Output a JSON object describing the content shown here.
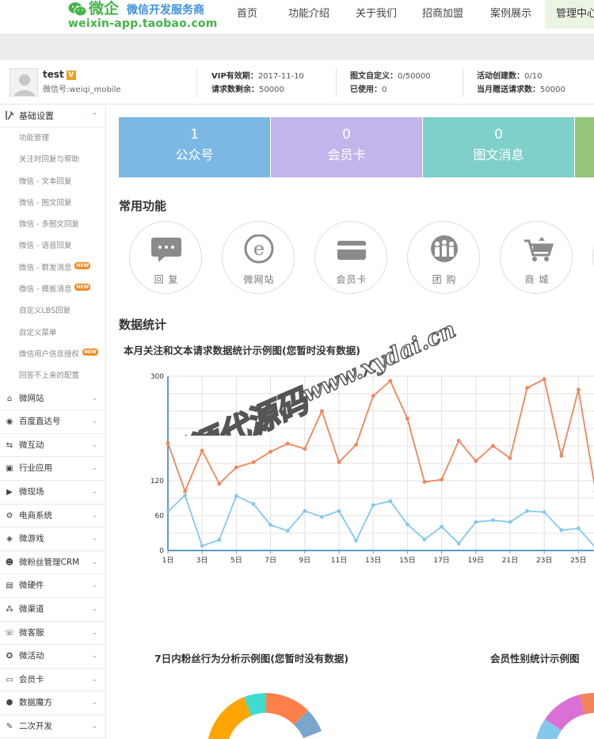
{
  "header": {
    "brand": "微企",
    "slogan": "微信开发服务商",
    "domain": "weixin-app.taobao.com",
    "nav": [
      "首页",
      "功能介绍",
      "关于我们",
      "招商加盟",
      "案例展示",
      "管理中心"
    ]
  },
  "account": {
    "name": "test",
    "badge": "V",
    "wechat_id": "微信号:weiqi_mobile",
    "vip_label": "VIP有效期：",
    "vip_value": "2017-11-10",
    "requests_label": "请求数剩余：",
    "requests_value": "50000",
    "custom_label": "图文自定义：",
    "custom_value": "0/50000",
    "used_label": "已使用：",
    "used_value": "0",
    "activity_label": "活动创建数：",
    "activity_value": "0/10",
    "gift_label": "当月赠送请求数：",
    "gift_value": "50000"
  },
  "sidebar": {
    "basic": {
      "label": "基础设置",
      "items": [
        {
          "label": "功能管理",
          "new": false
        },
        {
          "label": "关注时回复与帮助",
          "new": false
        },
        {
          "label": "微信 - 文本回复",
          "new": false
        },
        {
          "label": "微信 - 图文回复",
          "new": false
        },
        {
          "label": "微信 - 多图文回复",
          "new": false
        },
        {
          "label": "微信 - 语音回复",
          "new": false
        },
        {
          "label": "微信 - 群发消息",
          "new": true
        },
        {
          "label": "微信 - 模板消息",
          "new": true
        },
        {
          "label": "自定义LBS回复",
          "new": false
        },
        {
          "label": "自定义菜单",
          "new": false
        },
        {
          "label": "微信用户信息授权",
          "new": true
        },
        {
          "label": "回答不上来的配置",
          "new": false
        }
      ],
      "new_badge": "NEW"
    },
    "groups": [
      {
        "label": "微网站",
        "icon": "home-icon"
      },
      {
        "label": "百度直达号",
        "icon": "baidu-icon"
      },
      {
        "label": "微互动",
        "icon": "interact-icon"
      },
      {
        "label": "行业应用",
        "icon": "industry-icon"
      },
      {
        "label": "微现场",
        "icon": "video-icon"
      },
      {
        "label": "电商系统",
        "icon": "gear-icon"
      },
      {
        "label": "微游戏",
        "icon": "gamepad-icon"
      },
      {
        "label": "微粉丝管理CRM",
        "icon": "fans-icon"
      },
      {
        "label": "微硬件",
        "icon": "hardware-icon"
      },
      {
        "label": "微渠道",
        "icon": "channel-icon"
      },
      {
        "label": "微客服",
        "icon": "service-icon"
      },
      {
        "label": "微活动",
        "icon": "activity-icon"
      },
      {
        "label": "会员卡",
        "icon": "card-icon"
      },
      {
        "label": "数据魔方",
        "icon": "cube-icon"
      },
      {
        "label": "二次开发",
        "icon": "wrench-icon"
      }
    ]
  },
  "tiles": [
    {
      "num": "1",
      "label": "公众号",
      "color": "#7cb8e4"
    },
    {
      "num": "0",
      "label": "会员卡",
      "color": "#c4b4ec"
    },
    {
      "num": "0",
      "label": "图文消息",
      "color": "#7fd0ca"
    },
    {
      "num": "",
      "label": "",
      "color": "#96c479"
    }
  ],
  "sections": {
    "common": "常用功能",
    "stats": "数据统计"
  },
  "functions": [
    {
      "label": "回 复",
      "icon": "reply-icon"
    },
    {
      "label": "微网站",
      "icon": "website-icon"
    },
    {
      "label": "会员卡",
      "icon": "card-icon"
    },
    {
      "label": "团 购",
      "icon": "group-buy-icon"
    },
    {
      "label": "商 城",
      "icon": "mall-icon"
    }
  ],
  "chart_data": {
    "type": "line",
    "title": "本月关注和文本请求数据统计示例图(您暂时没有数据)",
    "x_labels": [
      "1日",
      "3日",
      "5日",
      "7日",
      "9日",
      "11日",
      "13日",
      "15日",
      "17日",
      "19日",
      "21日",
      "23日",
      "25日"
    ],
    "x": [
      1,
      2,
      3,
      4,
      5,
      6,
      7,
      8,
      9,
      10,
      11,
      12,
      13,
      14,
      15,
      16,
      17,
      18,
      19,
      20,
      21,
      22,
      23,
      24,
      25,
      26
    ],
    "y_ticks": [
      0,
      60,
      120,
      300
    ],
    "ylim": [
      0,
      300
    ],
    "grid": true,
    "series": [
      {
        "color": "#f2845a",
        "values": [
          185,
          102,
          172,
          115,
          143,
          152,
          170,
          184,
          175,
          240,
          152,
          182,
          266,
          292,
          227,
          118,
          122,
          189,
          154,
          180,
          159,
          280,
          295,
          163,
          277,
          102
        ]
      },
      {
        "color": "#84c8ee",
        "values": [
          67,
          95,
          8,
          18,
          94,
          80,
          44,
          34,
          68,
          58,
          68,
          17,
          78,
          85,
          45,
          19,
          41,
          12,
          49,
          52,
          49,
          68,
          66,
          35,
          38,
          5
        ]
      }
    ]
  },
  "sub_charts": {
    "fans": "7日内粉丝行为分析示例图(您暂时没有数据)",
    "gender": "会员性别统计示例图"
  },
  "watermark": {
    "text1": "新源代源码",
    "text2": "www.xydai.cn"
  }
}
